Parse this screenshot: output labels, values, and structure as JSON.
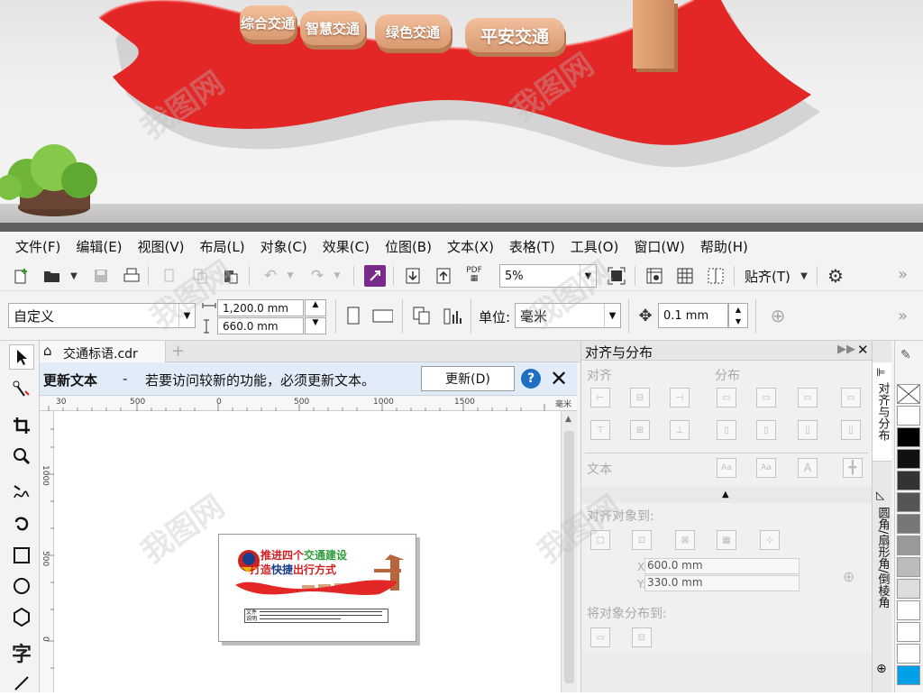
{
  "preview": {
    "plaques": [
      "综合交通",
      "智慧交通",
      "绿色交通",
      "平安交通"
    ]
  },
  "menu": [
    "文件(F)",
    "编辑(E)",
    "视图(V)",
    "布局(L)",
    "对象(C)",
    "效果(C)",
    "位图(B)",
    "文本(X)",
    "表格(T)",
    "工具(O)",
    "窗口(W)",
    "帮助(H)"
  ],
  "toolbar1": {
    "zoom_value": "5%",
    "snap_label": "贴齐(T)",
    "more": "»"
  },
  "toolbar2": {
    "preset_value": "自定义",
    "width_value": "1,200.0 mm",
    "height_value": "660.0 mm",
    "unit_label": "单位:",
    "unit_value": "毫米",
    "nudge_value": "0.1 mm",
    "more": "»"
  },
  "tab": {
    "doc_name": "交通标语.cdr",
    "add": "+"
  },
  "notice": {
    "title": "更新文本",
    "dash": "-",
    "message": "若要访问较新的功能，必须更新文本。",
    "button": "更新(D)"
  },
  "ruler": {
    "h_ticks": [
      "30",
      "500",
      "0",
      "500",
      "1000",
      "1500",
      "毫米"
    ],
    "v_ticks": [
      "1000",
      "500",
      "0"
    ]
  },
  "artwork": {
    "line1_a": "推进四个",
    "line1_b": "交通建设",
    "line2_a": "打造",
    "line2_b": "快捷",
    "line2_c": "出行方式",
    "caption_label": "文件说明"
  },
  "panel": {
    "title": "对齐与分布",
    "align_section": "对齐",
    "distribute_section": "分布",
    "text_section": "文本",
    "align_to_section": "对齐对象到:",
    "distribute_to_section": "将对象分布到:",
    "x_label": "X:",
    "x_value": "600.0 mm",
    "y_label": "Y:",
    "y_value": "330.0 mm"
  },
  "side_tabs": [
    "对齐与分布",
    "圆角/扇形角/倒棱角"
  ],
  "colors": {
    "accent_red": "#e32626",
    "plaque": "#e7ab83",
    "notice_bg": "#e1ecf8",
    "help_blue": "#1f6ec2",
    "green_text": "#2e9b3a"
  }
}
